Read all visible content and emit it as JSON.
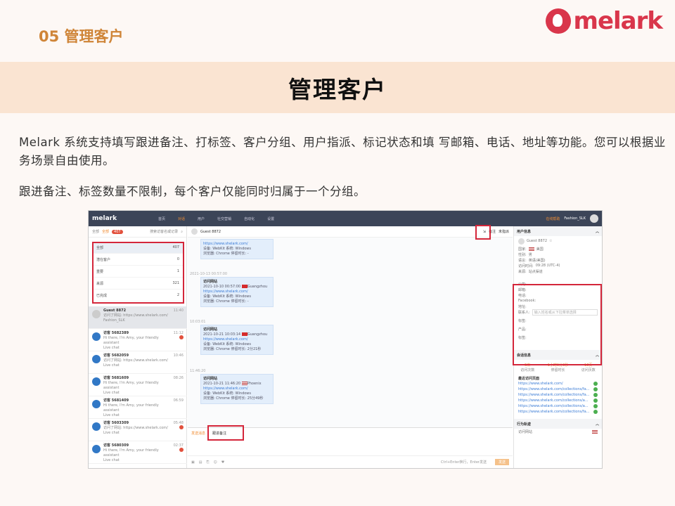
{
  "header": {
    "section_title": "05 管理客户",
    "logo_text": "melark"
  },
  "banner_title": "管理客户",
  "paragraphs": [
    "Melark 系统支持填写跟进备注、打标签、客户分组、用户指派、标记状态和填 写邮箱、电话、地址等功能。您可以根据业务场景自由使用。",
    "跟进备注、标签数量不限制，每个客户仅能同时归属于一个分组。"
  ],
  "app": {
    "logo": "melark",
    "nav": [
      "首页",
      "对话",
      "用户",
      "社交营销",
      "自动化",
      "设置"
    ],
    "online_help": "在线帮助",
    "store": "Fashion_SLK",
    "filter_label": "全部",
    "filter_active": "全部",
    "filter_count": "407",
    "search_placeholder": "搜索访客名或记录",
    "groups": [
      {
        "label": "全部",
        "count": "407"
      },
      {
        "label": "潜在客户",
        "count": "0"
      },
      {
        "label": "重要",
        "count": "1"
      },
      {
        "label": "来源",
        "count": "321"
      },
      {
        "label": "已完成",
        "count": "2"
      }
    ],
    "conversations": [
      {
        "name": "Guest 8872",
        "msg": "访问了网站: https://www.shelark.com/",
        "sub": "Fashion_SLK",
        "time": "11:40",
        "unread": ""
      },
      {
        "name": "访客 5682389",
        "msg": "Hi there, I'm Amy, your friendly assistant",
        "sub": "Live chat",
        "time": "11:12",
        "unread": "1"
      },
      {
        "name": "访客 5682059",
        "msg": "访问了网站: https://www.shelark.com/",
        "sub": "Live chat",
        "time": "10:46",
        "unread": ""
      },
      {
        "name": "访客 5681609",
        "msg": "Hi there, I'm Amy, your friendly assistant",
        "sub": "Live chat",
        "time": "08:26",
        "unread": ""
      },
      {
        "name": "访客 5681409",
        "msg": "Hi there, I'm Amy, your friendly assistant",
        "sub": "Live chat",
        "time": "06:59",
        "unread": ""
      },
      {
        "name": "访客 5603309",
        "msg": "访问了网站: https://www.shelark.com/",
        "sub": "Live chat",
        "time": "05:48",
        "unread": "2"
      },
      {
        "name": "访客 5680309",
        "msg": "Hi there, I'm Amy, your friendly assistant",
        "sub": "Live chat",
        "time": "02:37",
        "unread": "1"
      }
    ],
    "chat_header": "Guest 8872",
    "chat_tabs": [
      "备注",
      "未指派"
    ],
    "visits": [
      {
        "stamp": "",
        "title": "访问网站",
        "time": "",
        "url": "https://www.shelark.com/",
        "city": "",
        "device": "设备: WebKit",
        "os": "系统: Windows",
        "browser": "浏览器: Chrome",
        "stay": "停留时长: -"
      },
      {
        "stamp": "2021-10-13 00:57:00",
        "title": "访问网站",
        "time": "2021-10-10 00:57:00",
        "url": "https://www.shelark.com/",
        "city": "Guangzhou",
        "device": "设备: WebKit",
        "os": "系统: Windows",
        "browser": "浏览器: Chrome",
        "stay": "停留时长: -"
      },
      {
        "stamp": "10:03:01",
        "title": "访问网站",
        "time": "2021-10-21 10:03:14",
        "url": "https://www.shelark.com/",
        "city": "Guangzhou",
        "device": "设备: WebKit",
        "os": "系统: Windows",
        "browser": "浏览器: Chrome",
        "stay": "停留时长: 2分21秒"
      },
      {
        "stamp": "11:46:20",
        "title": "访问网站",
        "time": "2021-10-21 11:46:20",
        "url": "https://www.shelark.com/",
        "city": "Phoenix",
        "device": "设备: WebKit",
        "os": "系统: Windows",
        "browser": "浏览器: Chrome",
        "stay": "停留时长: 25分49秒"
      }
    ],
    "input_tab_left": "发送消息",
    "input_tab_right": "跟进备注",
    "send_label": "发送",
    "send_hint": "Ctrl+Enter换行，Enter发送",
    "right_panel": {
      "user_info_title": "用户信息",
      "guest_name": "Guest 8872",
      "fields": [
        "国家:",
        "性别:",
        "语言:",
        "访问时间:",
        "来源:"
      ],
      "field_values": [
        "美国",
        "男",
        "英语(美国)",
        "09:28 (UTC-4)",
        "站点渠道"
      ],
      "contact_fields": [
        "公司:",
        "邮箱:",
        "电话:",
        "Facebook:",
        "地址:",
        "联系人:"
      ],
      "assign_placeholder": "输入姓名或从下拉菜单选择",
      "tags_label": "标签:",
      "products_label": "产品:",
      "group_label": "标签:",
      "session_title": "会话信息",
      "session_stats": [
        {
          "label": "访问次数",
          "value": "5次"
        },
        {
          "label": "停留时长",
          "value": "1小时0分0秒"
        },
        {
          "label": "访问页数",
          "value": "18页"
        }
      ],
      "recent_title": "最近访问页面",
      "recent_pages": [
        "https://www.shelark.com/",
        "https://www.shelark.com/collections/fa...",
        "https://www.shelark.com/collections/fa...",
        "https://www.shelark.com/collections/a...",
        "https://www.shelark.com/collections/a...",
        "https://www.shelark.com/collections/fa..."
      ],
      "behavior_title": "行为轨迹",
      "behavior_item": "访问网站"
    }
  }
}
